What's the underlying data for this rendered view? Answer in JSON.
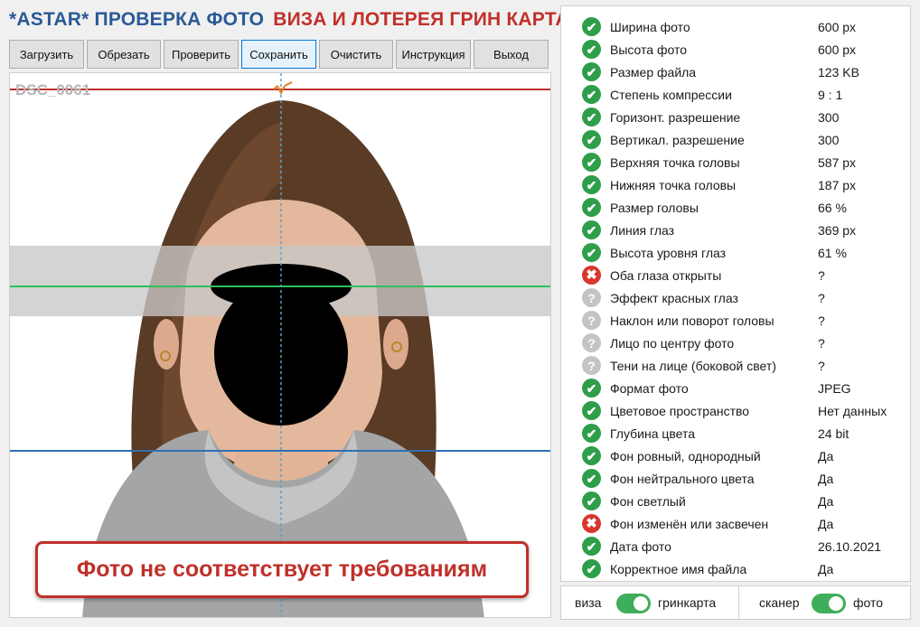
{
  "header": {
    "title_part1": "*ASTAR* ПРОВЕРКА ФОТО",
    "title_part2": "ВИЗА И ЛОТЕРЕЯ ГРИН КАРТА"
  },
  "toolbar": {
    "load": "Загрузить",
    "crop": "Обрезать",
    "check": "Проверить",
    "save": "Сохранить",
    "clear": "Очистить",
    "instructions": "Инструкция",
    "exit": "Выход"
  },
  "photo": {
    "file_name": "DSC_0061",
    "result_message": "Фото не соответствует требованиям"
  },
  "checks": [
    {
      "label": "Ширина фото",
      "value": "600 px",
      "status": "ok"
    },
    {
      "label": "Высота фото",
      "value": "600 px",
      "status": "ok"
    },
    {
      "label": "Размер файла",
      "value": "123 KB",
      "status": "ok"
    },
    {
      "label": "Степень компрессии",
      "value": "9 : 1",
      "status": "ok"
    },
    {
      "label": "Горизонт. разрешение",
      "value": "300",
      "status": "ok"
    },
    {
      "label": "Вертикал. разрешение",
      "value": "300",
      "status": "ok"
    },
    {
      "label": "Верхняя точка головы",
      "value": "587 px",
      "status": "ok"
    },
    {
      "label": "Нижняя точка головы",
      "value": "187 px",
      "status": "ok"
    },
    {
      "label": "Размер головы",
      "value": "66 %",
      "status": "ok"
    },
    {
      "label": "Линия глаз",
      "value": "369 px",
      "status": "ok"
    },
    {
      "label": "Высота уровня глаз",
      "value": "61 %",
      "status": "ok"
    },
    {
      "label": "Оба глаза открыты",
      "value": "?",
      "status": "bad"
    },
    {
      "label": "Эффект красных глаз",
      "value": "?",
      "status": "unknown"
    },
    {
      "label": "Наклон или поворот головы",
      "value": "?",
      "status": "unknown"
    },
    {
      "label": "Лицо по центру фото",
      "value": "?",
      "status": "unknown"
    },
    {
      "label": "Тени на лице (боковой свет)",
      "value": "?",
      "status": "unknown"
    },
    {
      "label": "Формат фото",
      "value": "JPEG",
      "status": "ok"
    },
    {
      "label": "Цветовое пространство",
      "value": "Нет данных",
      "status": "ok"
    },
    {
      "label": "Глубина цвета",
      "value": "24 bit",
      "status": "ok"
    },
    {
      "label": "Фон ровный, однородный",
      "value": "Да",
      "status": "ok"
    },
    {
      "label": "Фон нейтрального цвета",
      "value": "Да",
      "status": "ok"
    },
    {
      "label": "Фон светлый",
      "value": "Да",
      "status": "ok"
    },
    {
      "label": "Фон изменён или засвечен",
      "value": "Да",
      "status": "bad"
    },
    {
      "label": "Дата фото",
      "value": "26.10.2021",
      "status": "ok"
    },
    {
      "label": "Корректное имя файла",
      "value": "Да",
      "status": "ok"
    }
  ],
  "toggles": {
    "left_off": "виза",
    "left_on": "гринкарта",
    "left_state": "on",
    "right_off": "сканер",
    "right_on": "фото",
    "right_state": "on"
  },
  "colors": {
    "title_blue": "#2a5a96",
    "title_red": "#c0302a",
    "ok": "#2e9e4a",
    "bad": "#d9362c",
    "unknown": "#c4c4c4",
    "switch_on": "#3fae5a",
    "top_line": "#c0302a",
    "eye_line": "#2ec05a",
    "chin_line": "#2f6fb0",
    "center_line": "#5aa0c8"
  }
}
